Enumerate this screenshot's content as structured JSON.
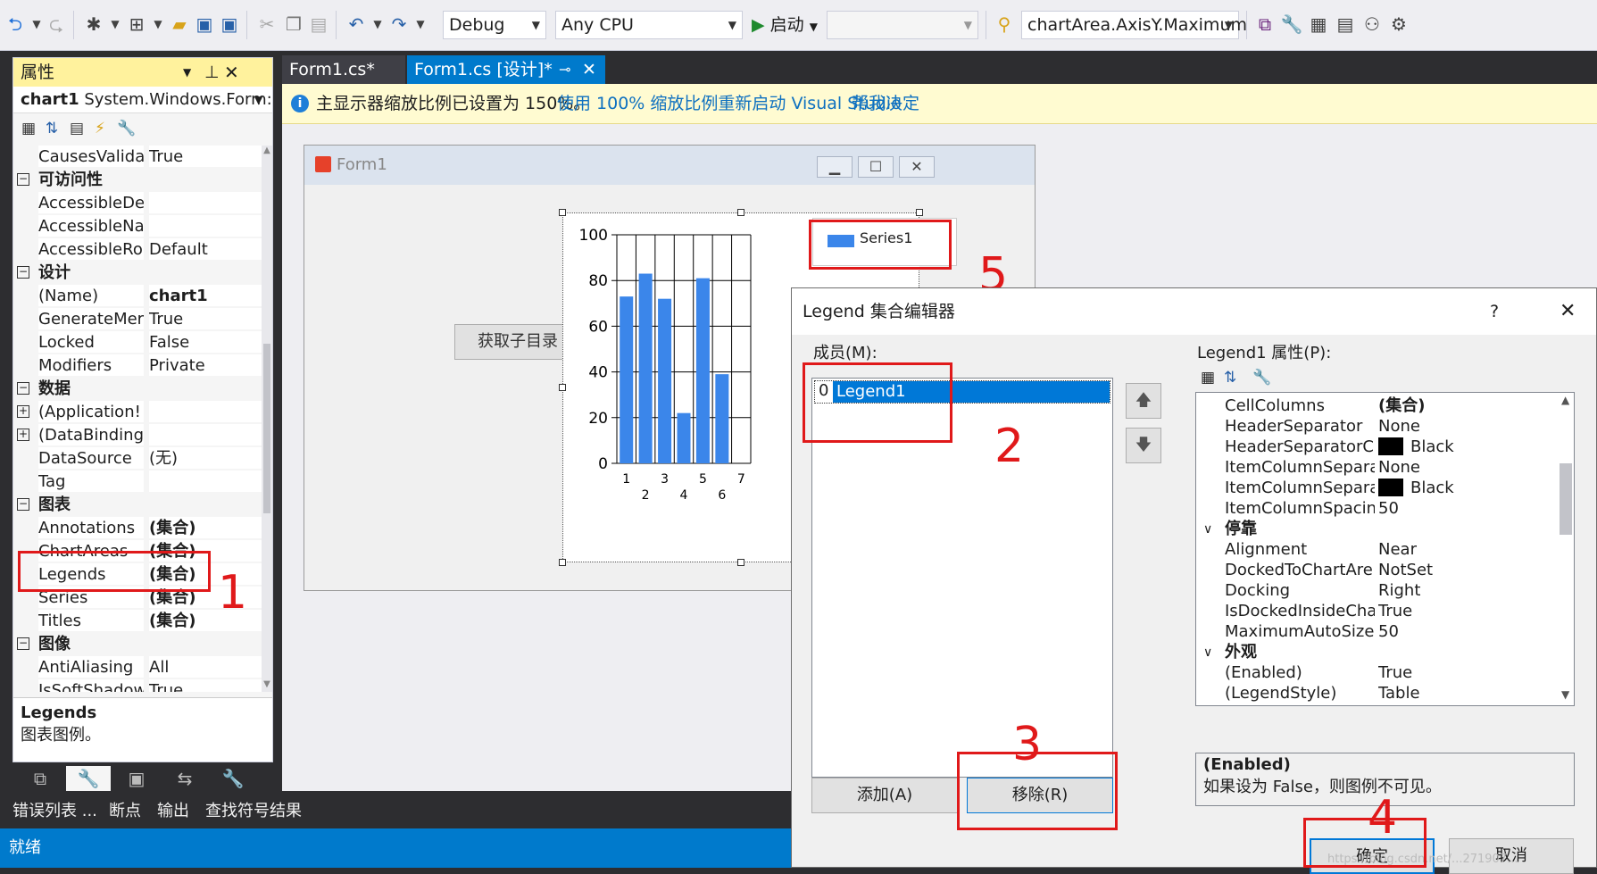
{
  "toolbar": {
    "config": "Debug",
    "platform": "Any CPU",
    "start_label": "启动",
    "find_value": "chartArea.AxisY.Maximum"
  },
  "properties": {
    "title": "属性",
    "object_name": "chart1",
    "object_type": "System.Windows.Form:",
    "rows": [
      {
        "name": "CausesValida",
        "value": "True"
      },
      {
        "category": "可访问性"
      },
      {
        "name": "AccessibleDe",
        "value": ""
      },
      {
        "name": "AccessibleNa",
        "value": ""
      },
      {
        "name": "AccessibleRo",
        "value": "Default"
      },
      {
        "category": "设计"
      },
      {
        "name": "(Name)",
        "value": "chart1",
        "bold": true
      },
      {
        "name": "GenerateMer",
        "value": "True"
      },
      {
        "name": "Locked",
        "value": "False"
      },
      {
        "name": "Modifiers",
        "value": "Private"
      },
      {
        "category": "数据"
      },
      {
        "name": "(Application!",
        "value": "",
        "expandable": true
      },
      {
        "name": "(DataBinding",
        "value": "",
        "expandable": true
      },
      {
        "name": "DataSource",
        "value": "(无)"
      },
      {
        "name": "Tag",
        "value": ""
      },
      {
        "category": "图表"
      },
      {
        "name": "Annotations",
        "value": "(集合)",
        "bold": true
      },
      {
        "name": "ChartAreas",
        "value": "(集合)",
        "bold": true
      },
      {
        "name": "Legends",
        "value": "(集合)",
        "bold": true
      },
      {
        "name": "Series",
        "value": "(集合)",
        "bold": true
      },
      {
        "name": "Titles",
        "value": "(集合)",
        "bold": true
      },
      {
        "category": "图像"
      },
      {
        "name": "AntiAliasing",
        "value": "All"
      },
      {
        "name": "IsSoftShadow",
        "value": "True"
      }
    ],
    "desc_title": "Legends",
    "desc_text": "图表图例。"
  },
  "doc_tabs": [
    "Form1.cs*",
    "Form1.cs [设计]*"
  ],
  "info_bar": {
    "message": "主显示器缩放比例已设置为 150%。",
    "link1": "使用 100% 缩放比例重新启动 Visual Studio",
    "link2": "帮我决定"
  },
  "form": {
    "title": "Form1",
    "button_label": "获取子目录"
  },
  "chart_data": {
    "type": "bar",
    "categories": [
      "1",
      "2",
      "3",
      "4",
      "5",
      "6",
      "7"
    ],
    "values": [
      73,
      83,
      72,
      22,
      81,
      39
    ],
    "ylim": [
      0,
      100
    ],
    "yticks": [
      "0",
      "20",
      "40",
      "60",
      "80",
      "100"
    ],
    "xticks_top": [
      "1",
      "3",
      "5",
      "7"
    ],
    "xticks_bottom": [
      "2",
      "4",
      "6"
    ],
    "legend": "Series1",
    "bar_color": "#3b86ea"
  },
  "dialog": {
    "title": "Legend 集合编辑器",
    "help": "?",
    "members_label": "成员(M):",
    "member_index": "0",
    "member_name": "Legend1",
    "props_label": "Legend1 属性(P):",
    "prop_rows": [
      {
        "name": "CellColumns",
        "value": "(集合)",
        "bold": true
      },
      {
        "name": "HeaderSeparator",
        "value": "None"
      },
      {
        "name": "HeaderSeparatorC",
        "value": "Black",
        "swatch": true
      },
      {
        "name": "ItemColumnSepara",
        "value": "None"
      },
      {
        "name": "ItemColumnSepara",
        "value": "Black",
        "swatch": true
      },
      {
        "name": "ItemColumnSpacin",
        "value": "50"
      },
      {
        "category": "停靠"
      },
      {
        "name": "Alignment",
        "value": "Near"
      },
      {
        "name": "DockedToChartAre",
        "value": "NotSet"
      },
      {
        "name": "Docking",
        "value": "Right"
      },
      {
        "name": "IsDockedInsideCha",
        "value": "True"
      },
      {
        "name": "MaximumAutoSize",
        "value": "50"
      },
      {
        "category": "外观"
      },
      {
        "name": "(Enabled)",
        "value": "True"
      },
      {
        "name": "(LegendStyle)",
        "value": "Table"
      }
    ],
    "desc_title": "(Enabled)",
    "desc_text": "如果设为 False，则图例不可见。",
    "add_label": "添加(A)",
    "remove_label": "移除(R)",
    "ok_label": "确定",
    "cancel_label": "取消"
  },
  "annotations": [
    "1",
    "2",
    "3",
    "4",
    "5"
  ],
  "bottom_tabs": [
    "错误列表 ...",
    "断点",
    "输出",
    "查找符号结果"
  ],
  "status": "就绪",
  "watermark": "https://blog.csdn.net/...271907..."
}
